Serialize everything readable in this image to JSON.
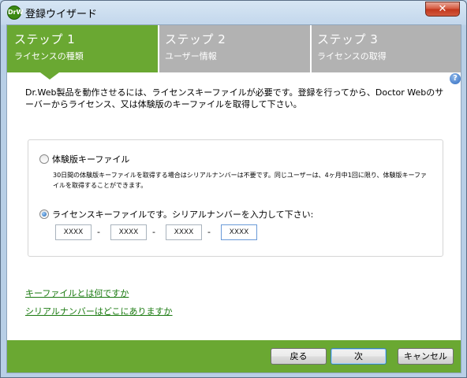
{
  "window": {
    "title": "登録ウイザード",
    "app_icon_text": "DrW",
    "close_glyph": "✕"
  },
  "steps": [
    {
      "title": "ステップ 1",
      "subtitle": "ライセンスの種類",
      "active": true
    },
    {
      "title": "ステップ 2",
      "subtitle": "ユーザー情報",
      "active": false
    },
    {
      "title": "ステップ 3",
      "subtitle": "ライセンスの取得",
      "active": false
    }
  ],
  "help": {
    "glyph": "?"
  },
  "intro_text": "Dr.Web製品を動作させるには、ライセンスキーファイルが必要です。登録を行ってから、Doctor Webのサーバーからライセンス、又は体験版のキーファイルを取得して下さい。",
  "options": {
    "trial": {
      "label": "体験版キーファイル",
      "checked": false,
      "note": "30日間の体験版キーファイルを取得する場合はシリアルナンバーは不要です。同じユーザーは、4ヶ月中1回に限り、体験版キーファイルを取得することができます。"
    },
    "license": {
      "label": "ライセンスキーファイルです。シリアルナンバーを入力して下さい:",
      "checked": true
    }
  },
  "serial": {
    "fields": [
      "XXXX",
      "XXXX",
      "XXXX",
      "XXXX"
    ],
    "separator": "-"
  },
  "links": {
    "what_is_key": "キーファイルとは何ですか",
    "where_serial": "シリアルナンバーはどこにありますか"
  },
  "buttons": {
    "back": "戻る",
    "next": "次",
    "cancel": "キャンセル"
  },
  "colors": {
    "accent_green": "#6aa832",
    "inactive_step": "#b2b2b2",
    "link_green": "#1a7a10"
  }
}
